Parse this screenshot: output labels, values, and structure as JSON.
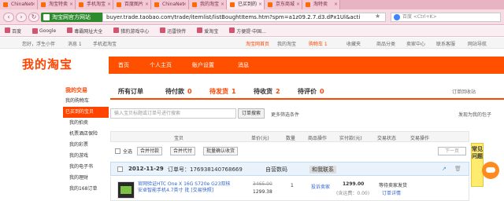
{
  "browser": {
    "tabs": [
      {
        "label": "ChinaNet",
        "active": false
      },
      {
        "label": "淘宝特卖",
        "active": false
      },
      {
        "label": "手机淘宝",
        "active": false
      },
      {
        "label": "百度图片",
        "active": false
      },
      {
        "label": "ChinaNet",
        "active": false
      },
      {
        "label": "我的淘宝",
        "active": false
      },
      {
        "label": "已买到的",
        "active": true
      },
      {
        "label": "京东商城",
        "active": false
      },
      {
        "label": "淘特卖",
        "active": false
      }
    ],
    "site_label": "淘宝网官方网站",
    "url": "buyer.trade.taobao.com/trade/itemlist/listBoughtItems.htm?spm=a1z09.2.7.d3.dPx1Ul&acti",
    "search_placeholder": "百度 <Ctrl+K>"
  },
  "bookmarks": [
    "百度",
    "Google",
    "毒霸网址大全",
    "猎豹游戏中心",
    "迅雷快传",
    "爱淘宝",
    "方便提·中国..."
  ],
  "taobao_top": {
    "greeting": "您好，浮生小伴",
    "msg": "消息 1",
    "mobile": "手机逛淘宝",
    "right_links": [
      "淘宝网首页",
      "我的淘宝",
      "购物车 1",
      "收藏夹",
      "商品分类",
      "卖家中心",
      "联系客服",
      "网站导航"
    ]
  },
  "header": {
    "logo": "我的淘宝",
    "nav": [
      "首页",
      "个人主页",
      "账户设置",
      "消息"
    ]
  },
  "sidebar": {
    "title": "我的交易",
    "items": [
      "我的购物车",
      "已买到的宝贝",
      "我的拍卖",
      "机票酒店保险",
      "我的彩票",
      "我的游戏",
      "我的电子书",
      "我的理财",
      "我的168订单"
    ]
  },
  "order_tabs": [
    {
      "label": "所有订单",
      "count": ""
    },
    {
      "label": "待付款",
      "count": "0"
    },
    {
      "label": "待发货",
      "count": "1"
    },
    {
      "label": "待收货",
      "count": "2"
    },
    {
      "label": "待评价",
      "count": "0"
    }
  ],
  "recycle": "订单回收站",
  "search": {
    "placeholder": "输入宝贝标题或订单号进行搜索",
    "button": "订单搜索",
    "more": "更多筛选条件",
    "quest": "发现为我的包子"
  },
  "table_header": [
    "宝贝",
    "单价(元)",
    "数量",
    "商品操作",
    "实付款(元)",
    "交易状态",
    "交易操作"
  ],
  "batch": {
    "select_all": "全选",
    "buttons": [
      "合并付款",
      "合并代付",
      "批量确认收货"
    ],
    "pager": "下一页"
  },
  "order": {
    "date": "2012-11-29",
    "order_no": "订单号：176938140768669",
    "shop": "自营数码",
    "contact": "和我联系",
    "title": "官网验证HTC One X 16G S720e G23双核安卓智能手机4.7英寸 批 [交易快照]",
    "orig_price": "3465.00",
    "price": "1299.38",
    "qty": "1",
    "op": "投诉卖家",
    "paid": "1299.00",
    "paid_note": "(含运费：0.00)",
    "status": "等待卖家发货",
    "detail": "订单详情"
  },
  "help": "常见问题"
}
